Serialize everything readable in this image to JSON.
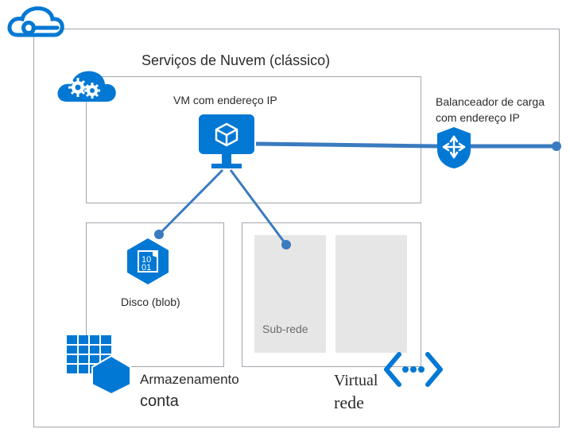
{
  "diagram": {
    "title": "Serviços de Nuvem (clássico)",
    "vm_label": "VM com endereço IP",
    "lb_label_line1": "Balanceador de carga",
    "lb_label_line2": "com endereço IP",
    "disk_label": "Disco (blob)",
    "subnet_label": "Sub-rede",
    "storage_label_line1": "Armazenamento",
    "storage_label_line2": "conta",
    "vnet_label_line1": "Virtual",
    "vnet_label_line2": "rede"
  }
}
